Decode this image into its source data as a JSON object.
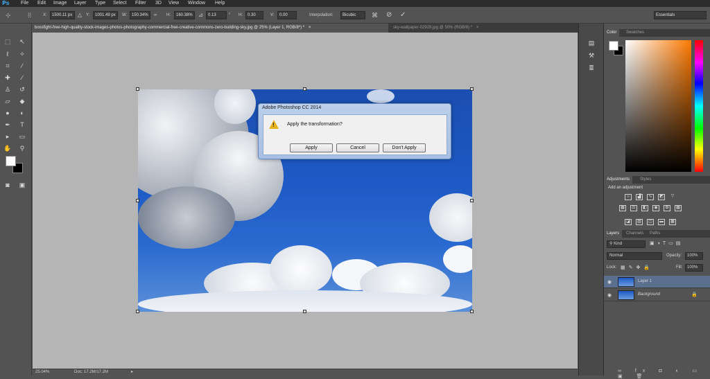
{
  "app": {
    "logo": "Ps"
  },
  "menubar": [
    "File",
    "Edit",
    "Image",
    "Layer",
    "Type",
    "Select",
    "Filter",
    "3D",
    "View",
    "Window",
    "Help"
  ],
  "options": {
    "x_label": "X:",
    "x_value": "1500.11 px",
    "y_label": "Y:",
    "y_value": "1001.49 px",
    "w_label": "W:",
    "w_value": "150.34%",
    "h_label": "H:",
    "h_value": "160.38%",
    "angle_value": "0.13",
    "hskew_label": "H:",
    "hskew_value": "0.30",
    "vskew_label": "V:",
    "vskew_value": "0.00",
    "interp_label": "Interpolation:",
    "interp_value": "Bicubic",
    "workspace": "Essentials"
  },
  "tabs": [
    {
      "label": "bossfight-free-high-quality-stock-images-photos-photography-commercial-free-creative-commons-zero-building-sky.jpg @ 25% (Layer 1, RGB/8*) *",
      "close": "×"
    },
    {
      "label": "sky-wallpaper-02929.jpg @ 50% (RGB/8) *",
      "close": "×"
    }
  ],
  "status": {
    "zoom": "25.04%",
    "doc": "Doc: 17.2M/17.2M"
  },
  "dialog": {
    "title": "Adobe Photoshop CC 2014",
    "message": "Apply the transformation?",
    "apply": "Apply",
    "cancel": "Cancel",
    "dont_apply": "Don't Apply"
  },
  "panels": {
    "color_tabs": [
      "Color",
      "Swatches"
    ],
    "adjust_tabs": [
      "Adjustments",
      "Styles"
    ],
    "adjust_title": "Add an adjustment",
    "layers_tabs": [
      "Layers",
      "Channels",
      "Paths"
    ],
    "kind": "Kind",
    "blend": "Normal",
    "opacity_label": "Opacity:",
    "opacity_value": "100%",
    "lock_label": "Lock:",
    "fill_label": "Fill:",
    "fill_value": "100%",
    "layers": [
      {
        "name": "Layer 1"
      },
      {
        "name": "Background"
      }
    ]
  },
  "colors": {
    "accent": "#3fa5e8",
    "selected_layer": "#5b6f8f"
  }
}
